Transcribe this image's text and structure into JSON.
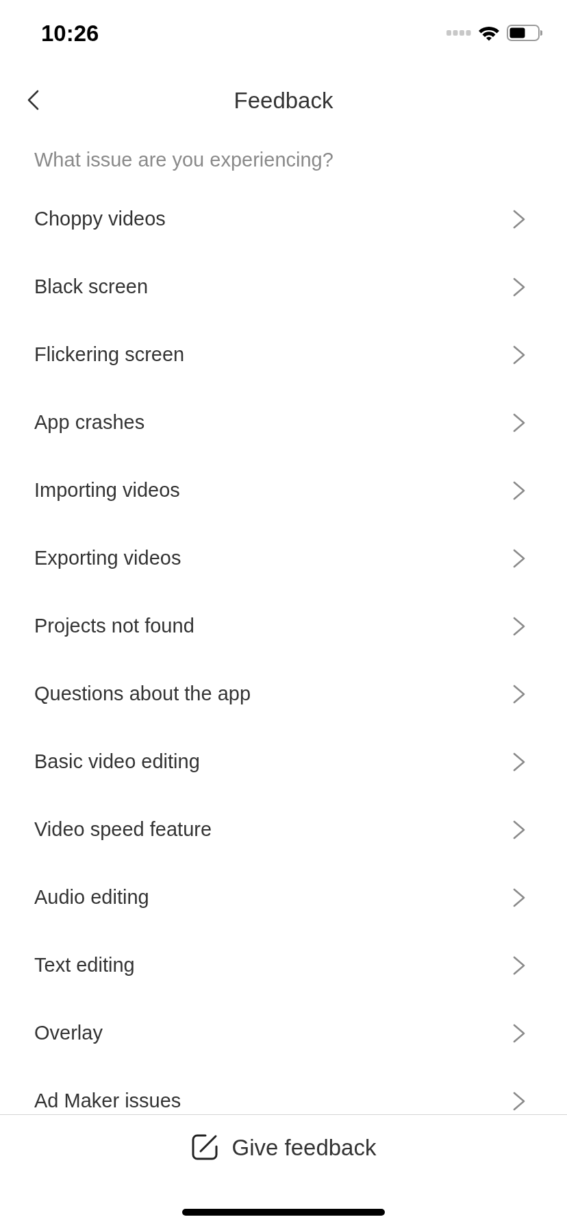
{
  "status_bar": {
    "time": "10:26"
  },
  "header": {
    "title": "Feedback"
  },
  "prompt": "What issue are you experiencing?",
  "issues": [
    "Choppy videos",
    "Black screen",
    "Flickering screen",
    "App crashes",
    "Importing videos",
    "Exporting videos",
    "Projects not found",
    "Questions about the app",
    "Basic video editing",
    "Video speed feature",
    "Audio editing",
    "Text editing",
    "Overlay",
    "Ad Maker issues"
  ],
  "footer": {
    "button": "Give feedback"
  }
}
